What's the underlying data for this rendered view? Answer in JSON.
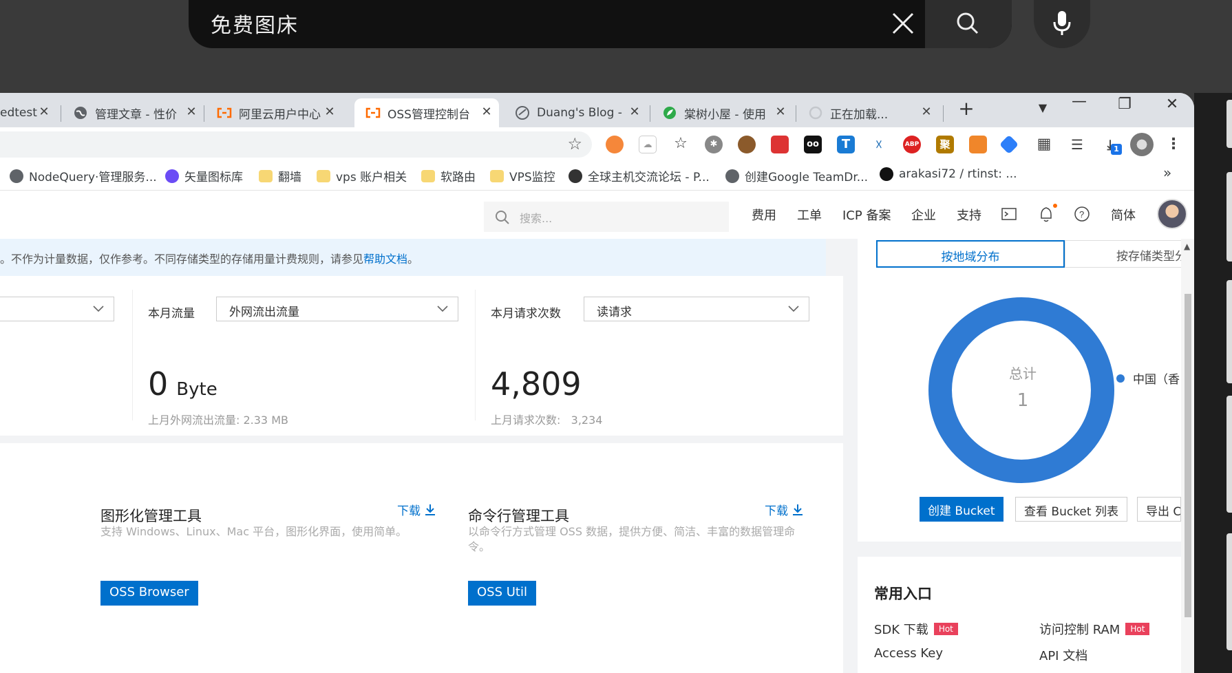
{
  "overlay": {
    "query": "免费图床",
    "close_icon": "close-icon",
    "search_icon": "search-icon",
    "mic_icon": "microphone-icon"
  },
  "tabs": [
    {
      "title": "edtest",
      "icon": "globe-icon"
    },
    {
      "title": "管理文章 - 性价",
      "icon": "globe-icon"
    },
    {
      "title": "阿里云用户中心",
      "icon": "aliyun-icon"
    },
    {
      "title": "OSS管理控制台",
      "icon": "aliyun-icon",
      "active": true
    },
    {
      "title": "Duang's Blog -",
      "icon": "blog-icon"
    },
    {
      "title": "棠树小屋 - 使用",
      "icon": "leaf-icon"
    },
    {
      "title": "正在加载...",
      "icon": "loading-icon"
    }
  ],
  "tab_close": "✕",
  "new_tab": "+",
  "window_controls": {
    "minimize": "—",
    "restore": "❐",
    "close": "✕"
  },
  "extensions_badge": "1",
  "bookmarks": [
    {
      "label": "NodeQuery·管理服务...",
      "icon": "globe-icon"
    },
    {
      "label": "矢量图标库",
      "icon": "iconfont-icon"
    },
    {
      "label": "翻墙",
      "icon": "folder-icon"
    },
    {
      "label": "vps 账户相关",
      "icon": "folder-icon"
    },
    {
      "label": "软路由",
      "icon": "folder-icon"
    },
    {
      "label": "VPS监控",
      "icon": "folder-icon"
    },
    {
      "label": "全球主机交流论坛 - P...",
      "icon": "forum-icon"
    },
    {
      "label": "创建Google TeamDr...",
      "icon": "globe-icon"
    },
    {
      "label": "arakasi72 / rtinst: ...",
      "icon": "github-icon"
    }
  ],
  "bookmarks_more": "»",
  "console": {
    "search_placeholder": "搜索...",
    "nav": [
      "费用",
      "工单",
      "ICP 备案",
      "企业",
      "支持"
    ],
    "lang": "简体"
  },
  "notice": {
    "text": "。不作为计量数据，仅作参考。不同存储类型的存储用量计费规则，请参见",
    "link": "帮助文档",
    "end": "。"
  },
  "stats": {
    "traffic": {
      "label": "本月流量",
      "select": "外网流出流量",
      "value": "0",
      "unit": "Byte",
      "sub": "上月外网流出流量: 2.33 MB"
    },
    "requests": {
      "label": "本月请求次数",
      "select": "读请求",
      "value": "4,809",
      "sub": "上月请求次数:   3,234"
    }
  },
  "tools": [
    {
      "title": "图形化管理工具",
      "download": "下载",
      "desc": "支持 Windows、Linux、Mac 平台，图形化界面，使用简单。",
      "button": "OSS Browser"
    },
    {
      "title": "命令行管理工具",
      "download": "下载",
      "desc": "以命令行方式管理 OSS 数据，提供方便、简洁、丰富的数据管理命令。",
      "button": "OSS Util"
    }
  ],
  "distribution": {
    "tab_active": "按地域分布",
    "tab_other": "按存储类型分",
    "total_label": "总计",
    "total_value": "1",
    "legend": "中国（香",
    "color": "#2f7bd4",
    "buttons": [
      "创建 Bucket",
      "查看 Bucket 列表",
      "导出 C"
    ]
  },
  "entries": {
    "title": "常用入口",
    "items": [
      {
        "label": "SDK 下载",
        "hot": "Hot"
      },
      {
        "label": "访问控制 RAM",
        "hot": "Hot"
      },
      {
        "label": "Access Key",
        "hot": ""
      },
      {
        "label": "API 文档",
        "hot": ""
      }
    ]
  },
  "colors": {
    "primary": "#0070cc",
    "hot": "#e9415c",
    "accent": "#ff6a00"
  }
}
